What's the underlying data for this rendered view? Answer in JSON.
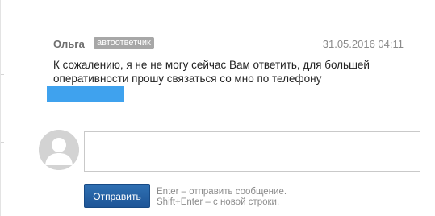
{
  "message": {
    "author": "Ольга",
    "badge": "автоответчик",
    "timestamp": "31.05.2016 04:11",
    "text": "К сожалению, я не не могу сейчас Вам ответить, для большей оперативности прошу связаться со мно по телефону"
  },
  "composer": {
    "placeholder": "",
    "send_label": "Отправить",
    "hint_enter": "Enter – отправить сообщение.",
    "hint_shift_enter": "Shift+Enter – с новой строки."
  },
  "icons": {
    "avatar": "user-silhouette-icon"
  },
  "colors": {
    "send_button": "#1e5597",
    "badge": "#a7a7a7",
    "redaction": "#3fa2ee"
  }
}
